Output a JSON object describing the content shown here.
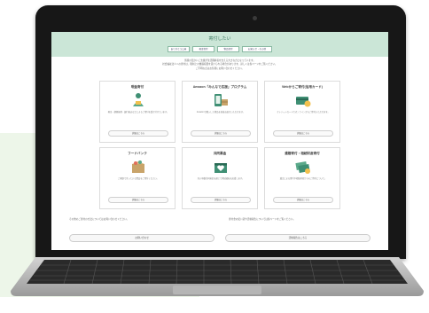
{
  "site": {
    "title": "寄付したい",
    "nav": [
      "ありがとう口座",
      "現金寄付",
      "物品寄付",
      "お知らせ・その他"
    ],
    "intro": [
      "皆様の温かいご支援が生活困窮者を支える大きな力となっています。",
      "社会福祉法人への寄付は、税制上の優遇措置を受けられる場合があります。詳しくは各ページをご覧ください。",
      "ご不明な点はお気軽にお問い合わせください。"
    ]
  },
  "cards": [
    {
      "title": "現金寄付",
      "desc": "現金・郵便振替・銀行振込などによるご寄付を受け付けています。",
      "button": "詳細はこちら",
      "icon": "person-donate-icon"
    },
    {
      "title": "Amazon「みんなで応援」プログラム",
      "desc": "Amazonで購入した物品を直接お届けいただけます。",
      "button": "詳細はこちら",
      "icon": "phone-package-icon"
    },
    {
      "title": "Webからご寄付(信用カード)",
      "desc": "クレジットカードでオンラインからご寄付いただけます。",
      "button": "詳細はこちら",
      "icon": "card-donate-icon"
    },
    {
      "title": "フードバンク",
      "desc": "ご家庭で余っている食品をご寄付ください。",
      "button": "詳細はこちら",
      "icon": "food-box-icon"
    },
    {
      "title": "共同募金",
      "desc": "赤い羽根共同募金を通じて地域福祉を応援します。",
      "button": "詳細はこちら",
      "icon": "heart-box-icon"
    },
    {
      "title": "遺贈寄付・相続財産寄付",
      "desc": "遺言による寄付や相続財産からのご寄付について。",
      "button": "詳細はこちら",
      "icon": "coins-money-icon"
    }
  ],
  "bottom": {
    "left_text": "その他のご寄付の方法についてはお問い合わせください。",
    "left_button": "お問い合わせ",
    "right_text": "寄付金の使い道や活動報告については各ページをご覧ください。",
    "right_button": "活動報告はこちら"
  },
  "colors": {
    "header_bg": "#cbe6d7",
    "accent": "#3f8f74",
    "panel_bg": "#edf6e9"
  }
}
